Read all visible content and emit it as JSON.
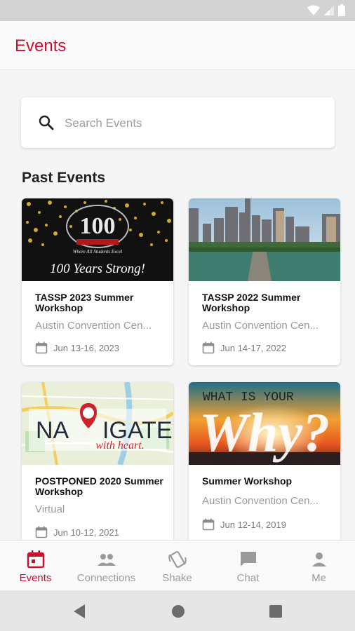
{
  "header": {
    "title": "Events"
  },
  "search": {
    "placeholder": "Search Events"
  },
  "past_events": {
    "title": "Past Events",
    "items": [
      {
        "title": "TASSP 2023 Summer Workshop",
        "location": "Austin Convention Cen...",
        "date": "Jun 13-16, 2023",
        "image_text": "100 Years Strong!",
        "image_subtext": "Where All Students Excel"
      },
      {
        "title": "TASSP 2022 Summer Workshop",
        "location": "Austin Convention Cen...",
        "date": "Jun 14-17, 2022"
      },
      {
        "title": "POSTPONED 2020 Summer Workshop",
        "location": "Virtual",
        "date": "Jun 10-12, 2021",
        "image_text_a": "NA",
        "image_text_b": "IGATE",
        "image_text_c": "with heart."
      },
      {
        "title": "Summer Workshop",
        "location": "Austin Convention Cen...",
        "date": "Jun 12-14, 2019",
        "image_text_a": "WHAT IS YOUR",
        "image_text_b": "Why?"
      }
    ]
  },
  "bottom_nav": {
    "items": [
      {
        "label": "Events",
        "icon": "calendar-icon",
        "active": true
      },
      {
        "label": "Connections",
        "icon": "people-icon",
        "active": false
      },
      {
        "label": "Shake",
        "icon": "shake-phone-icon",
        "active": false
      },
      {
        "label": "Chat",
        "icon": "chat-bubble-icon",
        "active": false
      },
      {
        "label": "Me",
        "icon": "person-icon",
        "active": false
      }
    ]
  },
  "colors": {
    "accent": "#c8102e",
    "inactive": "#9a9a9a",
    "background": "#f5f5f5"
  }
}
